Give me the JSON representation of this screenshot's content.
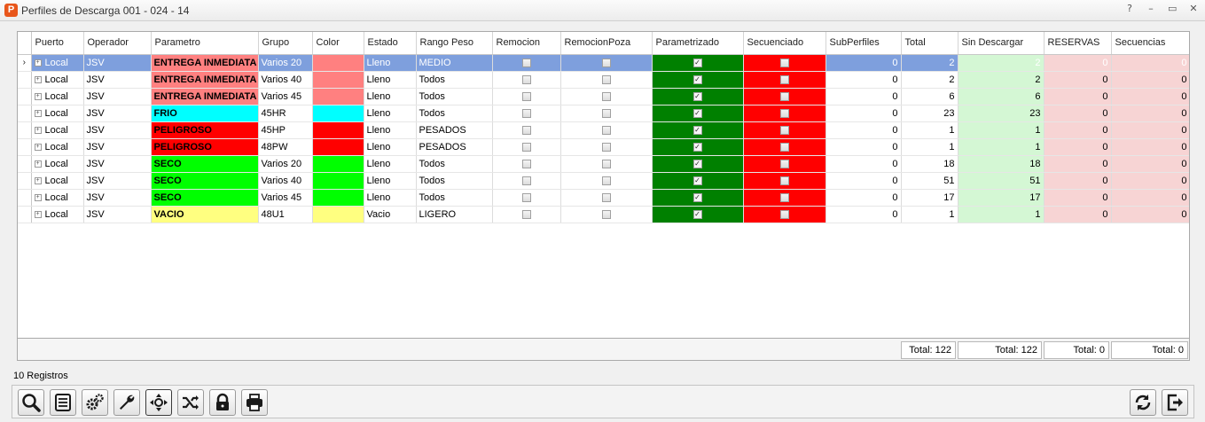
{
  "window": {
    "title": "Perfiles de Descarga 001 - 024 - 14",
    "controls": [
      "?",
      "–",
      "▭",
      "✕"
    ]
  },
  "grid": {
    "columns": [
      "Puerto",
      "Operador",
      "Parametro",
      "Grupo",
      "Color",
      "Estado",
      "Rango Peso",
      "Remocion",
      "RemocionPoza",
      "Parametrizado",
      "Secuenciado",
      "SubPerfiles",
      "Total",
      "Sin Descargar",
      "RESERVAS",
      "Secuencias"
    ],
    "colors": {
      "parametrizado_bg": "#008000",
      "secuenciado_bg": "#ff0000",
      "sin_descargar_bg": "#d4f7d4",
      "reservas_bg": "#f7d4d4",
      "secuencias_bg": "#f7d4d4",
      "selection_bg": "#7e9fdd"
    },
    "selected_row": 0,
    "rows": [
      {
        "puerto": "Local",
        "operador": "JSV",
        "parametro": "ENTREGA INMEDIATA",
        "grupo": "Varios 20",
        "color": "#ff8080",
        "estado": "Lleno",
        "rango": "MEDIO",
        "remocion": false,
        "remocion_poza": false,
        "parametrizado": true,
        "secuenciado": false,
        "subperfiles": "0",
        "total": "2",
        "sin_descargar": "2",
        "reservas": "0",
        "secuencias": "0"
      },
      {
        "puerto": "Local",
        "operador": "JSV",
        "parametro": "ENTREGA INMEDIATA",
        "grupo": "Varios 40",
        "color": "#ff8080",
        "estado": "Lleno",
        "rango": "Todos",
        "remocion": false,
        "remocion_poza": false,
        "parametrizado": true,
        "secuenciado": false,
        "subperfiles": "0",
        "total": "2",
        "sin_descargar": "2",
        "reservas": "0",
        "secuencias": "0"
      },
      {
        "puerto": "Local",
        "operador": "JSV",
        "parametro": "ENTREGA INMEDIATA",
        "grupo": "Varios 45",
        "color": "#ff8080",
        "estado": "Lleno",
        "rango": "Todos",
        "remocion": false,
        "remocion_poza": false,
        "parametrizado": true,
        "secuenciado": false,
        "subperfiles": "0",
        "total": "6",
        "sin_descargar": "6",
        "reservas": "0",
        "secuencias": "0"
      },
      {
        "puerto": "Local",
        "operador": "JSV",
        "parametro": "FRIO",
        "grupo": "45HR",
        "color": "#00ffff",
        "estado": "Lleno",
        "rango": "Todos",
        "remocion": false,
        "remocion_poza": false,
        "parametrizado": true,
        "secuenciado": false,
        "subperfiles": "0",
        "total": "23",
        "sin_descargar": "23",
        "reservas": "0",
        "secuencias": "0"
      },
      {
        "puerto": "Local",
        "operador": "JSV",
        "parametro": "PELIGROSO",
        "grupo": "45HP",
        "color": "#ff0000",
        "estado": "Lleno",
        "rango": "PESADOS",
        "remocion": false,
        "remocion_poza": false,
        "parametrizado": true,
        "secuenciado": false,
        "subperfiles": "0",
        "total": "1",
        "sin_descargar": "1",
        "reservas": "0",
        "secuencias": "0"
      },
      {
        "puerto": "Local",
        "operador": "JSV",
        "parametro": "PELIGROSO",
        "grupo": "48PW",
        "color": "#ff0000",
        "estado": "Lleno",
        "rango": "PESADOS",
        "remocion": false,
        "remocion_poza": false,
        "parametrizado": true,
        "secuenciado": false,
        "subperfiles": "0",
        "total": "1",
        "sin_descargar": "1",
        "reservas": "0",
        "secuencias": "0"
      },
      {
        "puerto": "Local",
        "operador": "JSV",
        "parametro": "SECO",
        "grupo": "Varios 20",
        "color": "#00ff00",
        "estado": "Lleno",
        "rango": "Todos",
        "remocion": false,
        "remocion_poza": false,
        "parametrizado": true,
        "secuenciado": false,
        "subperfiles": "0",
        "total": "18",
        "sin_descargar": "18",
        "reservas": "0",
        "secuencias": "0"
      },
      {
        "puerto": "Local",
        "operador": "JSV",
        "parametro": "SECO",
        "grupo": "Varios 40",
        "color": "#00ff00",
        "estado": "Lleno",
        "rango": "Todos",
        "remocion": false,
        "remocion_poza": false,
        "parametrizado": true,
        "secuenciado": false,
        "subperfiles": "0",
        "total": "51",
        "sin_descargar": "51",
        "reservas": "0",
        "secuencias": "0"
      },
      {
        "puerto": "Local",
        "operador": "JSV",
        "parametro": "SECO",
        "grupo": "Varios 45",
        "color": "#00ff00",
        "estado": "Lleno",
        "rango": "Todos",
        "remocion": false,
        "remocion_poza": false,
        "parametrizado": true,
        "secuenciado": false,
        "subperfiles": "0",
        "total": "17",
        "sin_descargar": "17",
        "reservas": "0",
        "secuencias": "0"
      },
      {
        "puerto": "Local",
        "operador": "JSV",
        "parametro": "VACIO",
        "grupo": "48U1",
        "color": "#ffff80",
        "estado": "Vacio",
        "rango": "LIGERO",
        "remocion": false,
        "remocion_poza": false,
        "parametrizado": true,
        "secuenciado": false,
        "subperfiles": "0",
        "total": "1",
        "sin_descargar": "1",
        "reservas": "0",
        "secuencias": "0"
      }
    ],
    "totals": {
      "total": "Total: 122",
      "sin_descargar": "Total: 122",
      "reservas": "Total: 0",
      "secuencias": "Total: 0"
    }
  },
  "status": {
    "records": "10 Registros"
  },
  "toolbar": {
    "buttons": [
      {
        "icon": "search-icon"
      },
      {
        "icon": "list-icon"
      },
      {
        "icon": "gears-icon"
      },
      {
        "icon": "wrench-icon"
      },
      {
        "icon": "fit-arrows-icon"
      },
      {
        "icon": "shuffle-icon"
      },
      {
        "icon": "lock-icon"
      },
      {
        "icon": "printer-icon"
      }
    ],
    "right_buttons": [
      {
        "icon": "refresh-icon"
      },
      {
        "icon": "exit-icon"
      }
    ]
  }
}
